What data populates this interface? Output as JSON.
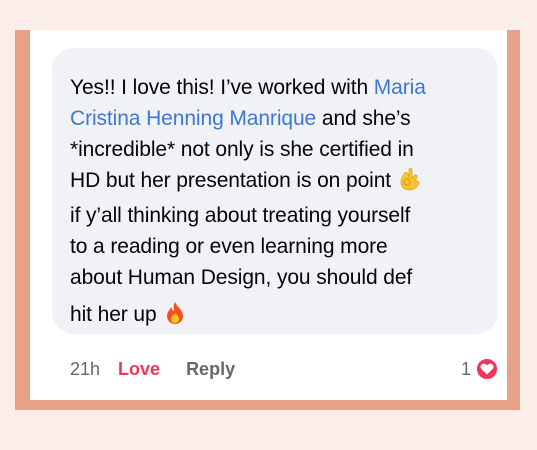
{
  "comment": {
    "line1_text": "Yes!! I love this! I’ve worked with ",
    "mention_part1": "Maria",
    "mention_part2": "Cristina Henning Manrique",
    "line2_after_mention": " and she’s",
    "line3": "*incredible* not only is she certified in",
    "line4": "HD but her presentation is on point",
    "line5": "if y’all thinking about treating yourself",
    "line6": "to a reading or even learning more",
    "line7": "about Human Design, you should def",
    "line8": "hit her up",
    "emoji_ok_hand": "ok-hand-emoji",
    "emoji_fire": "fire-emoji"
  },
  "actions": {
    "time": "21h",
    "love_label": "Love",
    "reply_label": "Reply"
  },
  "reaction": {
    "count": "1",
    "icon": "heart-icon"
  },
  "colors": {
    "background": "#fbeee9",
    "frame": "#e8a086",
    "bubble": "#f0f2f5",
    "mention": "#3b78d8",
    "love": "#f0365a",
    "meta": "#65676b"
  }
}
